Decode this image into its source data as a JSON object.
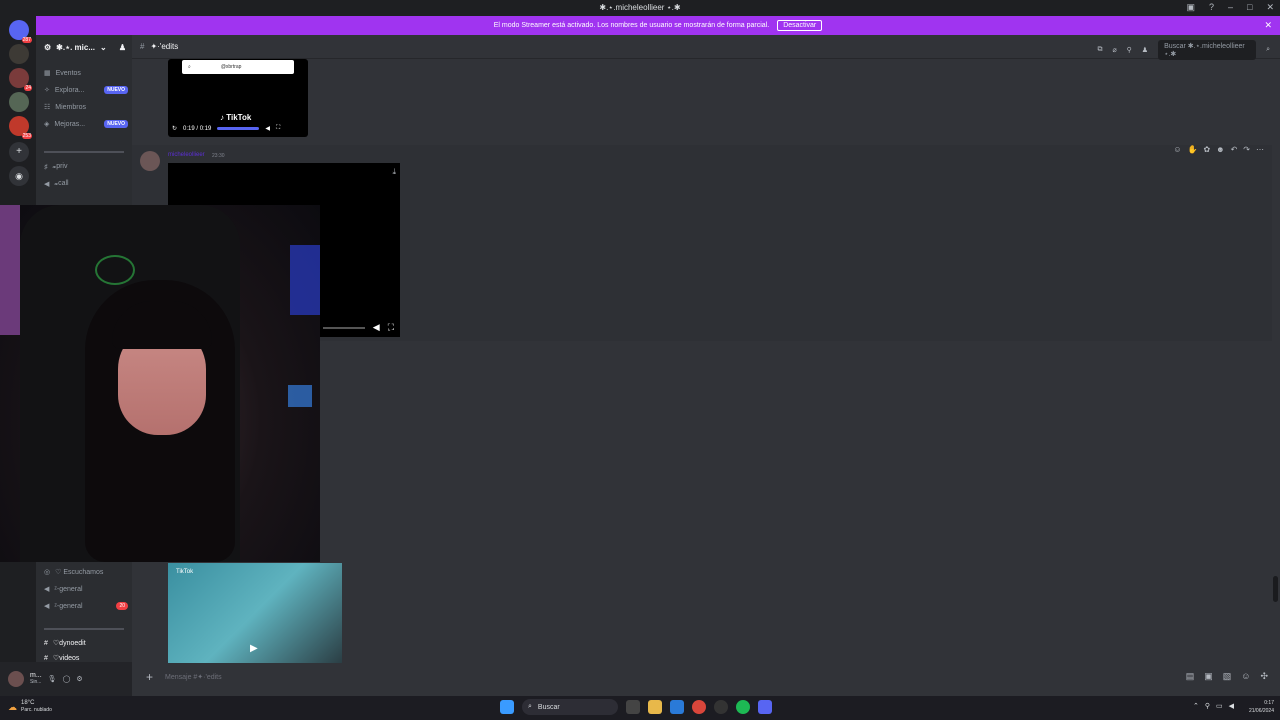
{
  "window": {
    "title": "✱.⋆.micheleollieer ⋆.✱"
  },
  "streamer_banner": {
    "text": "El modo Streamer está activado. Los nombres de usuario se mostrarán de forma parcial.",
    "button": "Desactivar"
  },
  "guilds": [
    {
      "badge": "287"
    },
    {
      "badge": ""
    },
    {
      "badge": "24"
    },
    {
      "badge": ""
    },
    {
      "badge": ""
    },
    {
      "badge": "253"
    }
  ],
  "server": {
    "name": "✱.⋆. mic..."
  },
  "channels": [
    {
      "icon": "calendar-icon",
      "label": "Eventos",
      "tag": ""
    },
    {
      "icon": "compass-icon",
      "label": "Explora...",
      "tag": "NUEVO"
    },
    {
      "icon": "members-icon",
      "label": "Miembros",
      "tag": ""
    },
    {
      "icon": "boost-icon",
      "label": "Mejoras...",
      "tag": "NUEVO"
    },
    {
      "icon": "hash-icon",
      "label": "𝔁priv",
      "tag": ""
    },
    {
      "icon": "speaker-icon",
      "label": "𝔁call",
      "tag": ""
    }
  ],
  "channels_lower": [
    {
      "label": "♡ Escuchamos",
      "count": ""
    },
    {
      "label": "ᶻ-general",
      "count": ""
    },
    {
      "label": "ᶻ-general",
      "count": "20"
    },
    {
      "label": "♡dynoedit",
      "count": ""
    },
    {
      "label": "♡videos",
      "count": ""
    }
  ],
  "header": {
    "channel": "✦·'edits",
    "search_placeholder": "Buscar ✱.⋆.micheleollieer ⋆.✱"
  },
  "messages": {
    "embed_search": "@xbrtrap",
    "tiktok_label": "TikTok",
    "tiktok_time": "0:19 / 0:19",
    "author": "micheleollieer",
    "time": "23:30"
  },
  "thumbnail": {
    "label": "TikTok"
  },
  "composer": {
    "placeholder": "Mensaje #✦·'edits"
  },
  "user_panel": {
    "name": "m...",
    "status": "Sin..."
  },
  "taskbar": {
    "weather_temp": "18°C",
    "weather_desc": "Parc. nublado",
    "search": "Buscar",
    "time": "0:17",
    "date": "21/06/2024"
  },
  "colors": {
    "banner": "#a034f0",
    "accent": "#5865f2",
    "badge_red": "#f23f43"
  }
}
